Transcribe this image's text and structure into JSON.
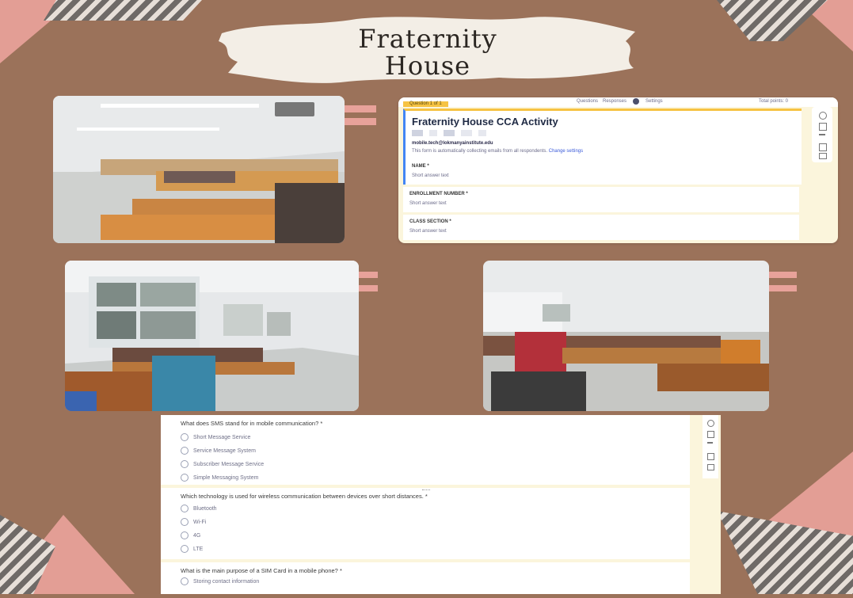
{
  "title": {
    "line1": "Fraternity",
    "line2": "House"
  },
  "form": {
    "tab_label": "Question 1 of 1",
    "top_links": [
      "Questions",
      "Responses",
      "Settings"
    ],
    "top_right": "Total points: 0",
    "heading": "Fraternity House CCA Activity",
    "email_line": "mobile.tech@lokmanyainstitute.edu",
    "info_line": "This form is automatically collecting emails from all respondents.",
    "info_link": "Change settings",
    "fields": [
      {
        "label": "NAME *",
        "placeholder": "Short answer text"
      },
      {
        "label": "ENROLLMENT NUMBER *",
        "placeholder": "Short answer text"
      },
      {
        "label": "CLASS SECTION *",
        "placeholder": "Short answer text"
      }
    ]
  },
  "quiz": {
    "questions": [
      {
        "text": "What does SMS stand for in mobile communication? *",
        "options": [
          "Short Message Service",
          "Service Message System",
          "Subscriber Message Service",
          "Simple Messaging System"
        ]
      },
      {
        "text": "Which technology is used for wireless communication between devices over short distances. *",
        "options": [
          "Bluetooth",
          "Wi-Fi",
          "4G",
          "LTE"
        ]
      },
      {
        "text": "What is the main purpose of a SIM Card in a mobile phone? *",
        "options": [
          "Storing contact information"
        ]
      }
    ]
  },
  "colors": {
    "background": "#9b725a",
    "accent": "#e8a29a",
    "form_yellow": "#f6c343",
    "form_bg": "#fbf5dc"
  }
}
